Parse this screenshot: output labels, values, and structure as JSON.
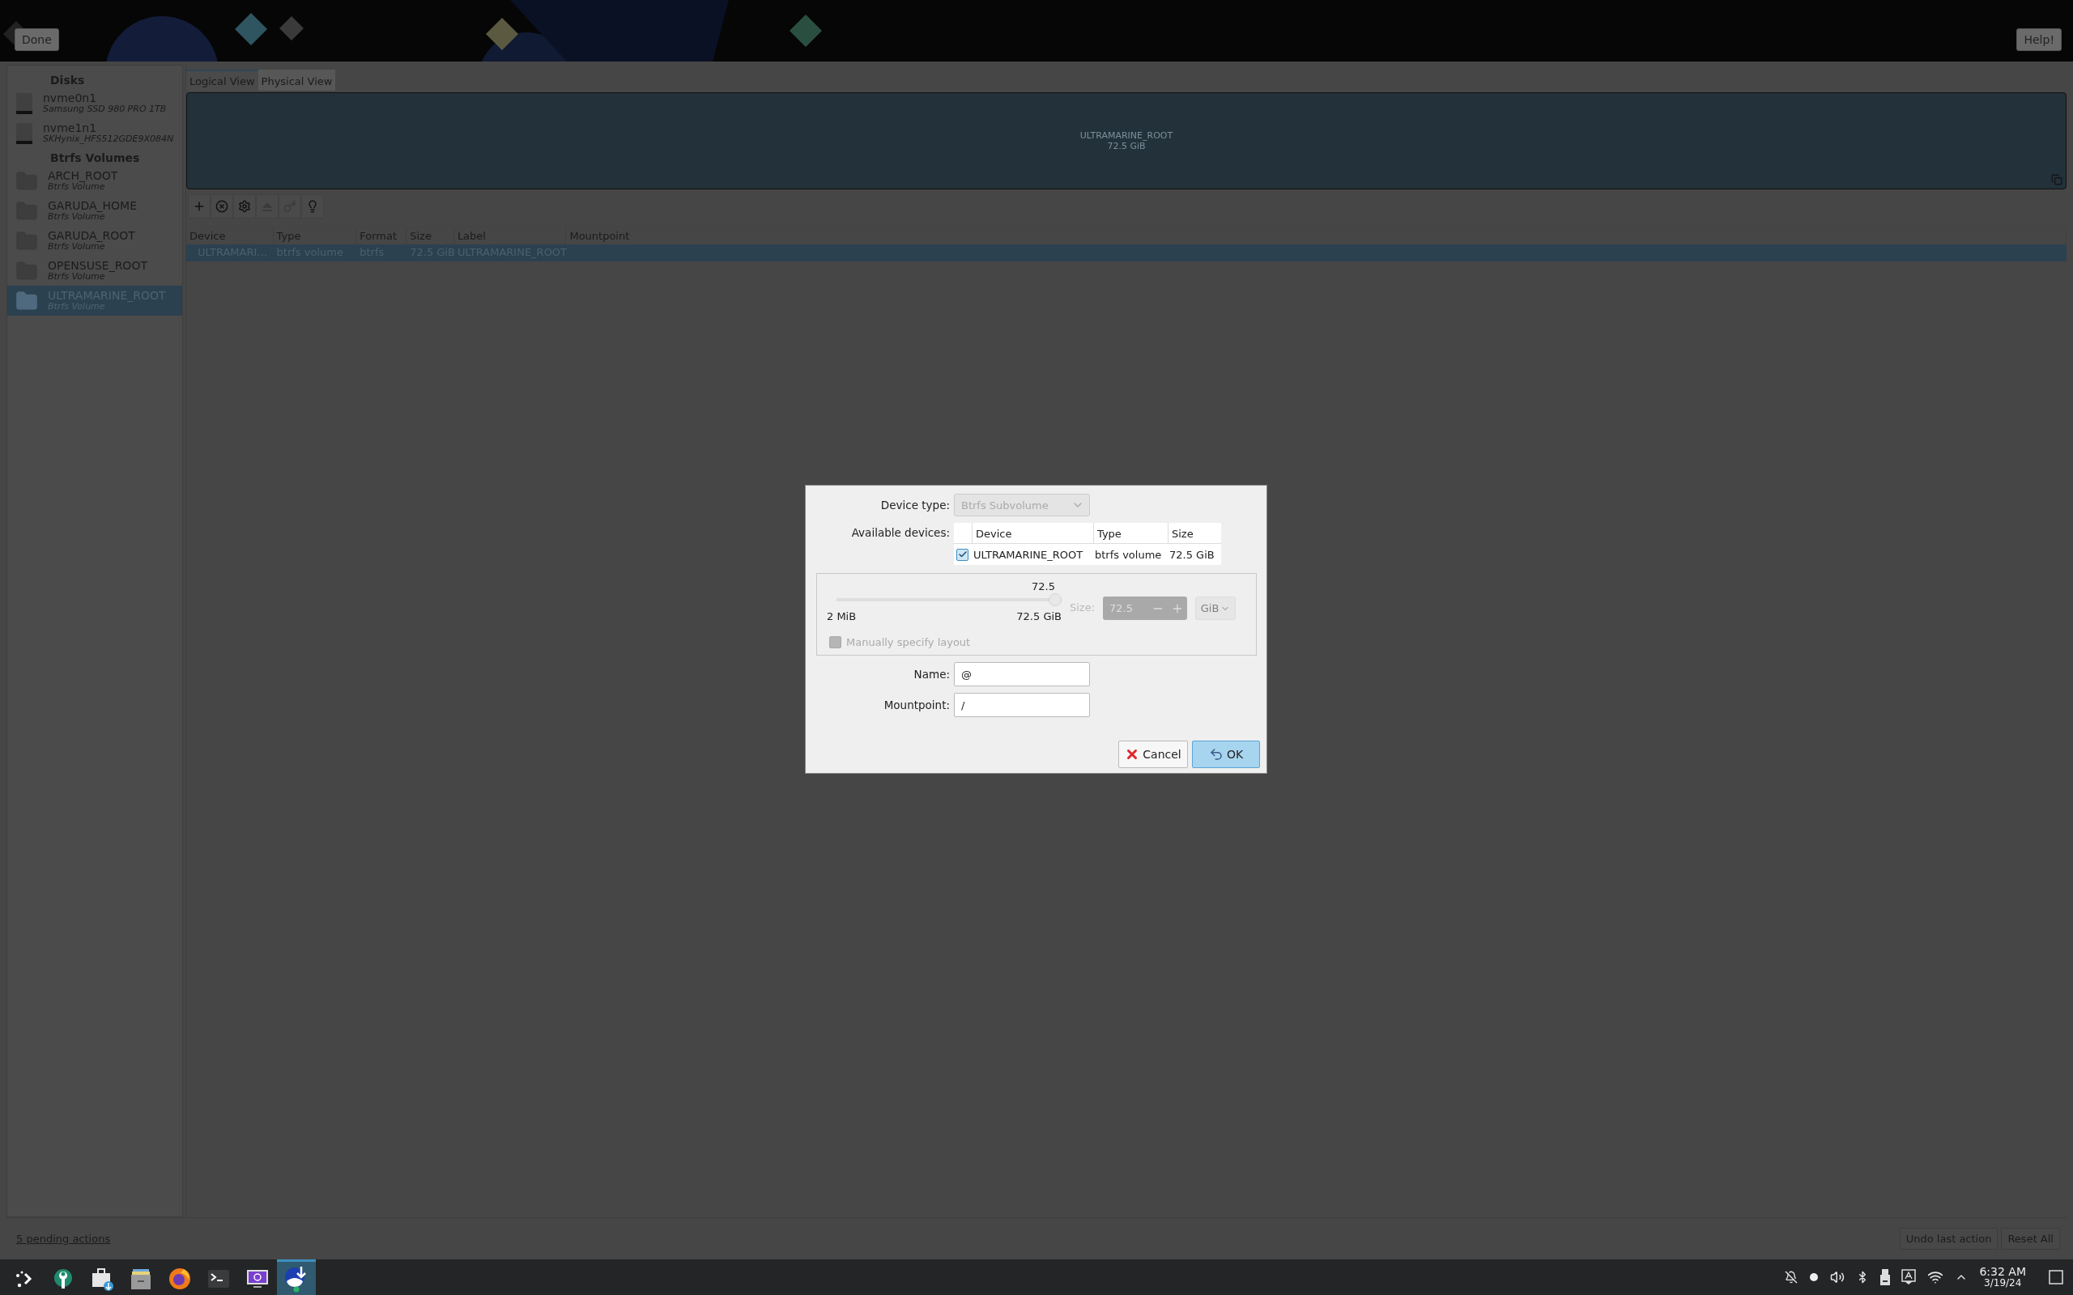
{
  "top_bar": {
    "done_button": "Done",
    "help_button": "Help!"
  },
  "sidebar": {
    "sections": [
      {
        "title": "Disks",
        "items": [
          {
            "name": "nvme0n1",
            "subtitle": "Samsung SSD 980 PRO 1TB",
            "kind": "disk",
            "selected": false
          },
          {
            "name": "nvme1n1",
            "subtitle": "SKHynix_HFS512GDE9X084N",
            "kind": "disk",
            "selected": false
          }
        ]
      },
      {
        "title": "Btrfs Volumes",
        "items": [
          {
            "name": "ARCH_ROOT",
            "subtitle": "Btrfs Volume",
            "kind": "volume",
            "selected": false
          },
          {
            "name": "GARUDA_HOME",
            "subtitle": "Btrfs Volume",
            "kind": "volume",
            "selected": false
          },
          {
            "name": "GARUDA_ROOT",
            "subtitle": "Btrfs Volume",
            "kind": "volume",
            "selected": false
          },
          {
            "name": "OPENSUSE_ROOT",
            "subtitle": "Btrfs Volume",
            "kind": "volume",
            "selected": false
          },
          {
            "name": "ULTRAMARINE_ROOT",
            "subtitle": "Btrfs Volume",
            "kind": "volume",
            "selected": true
          }
        ]
      }
    ]
  },
  "tabs": [
    {
      "label": "Logical View",
      "selected": true
    },
    {
      "label": "Physical View",
      "selected": false
    }
  ],
  "visualization": {
    "label": "ULTRAMARINE_ROOT",
    "size": "72.5 GiB"
  },
  "toolbar": [
    {
      "kind": "add",
      "disabled": false
    },
    {
      "kind": "remove",
      "disabled": false
    },
    {
      "kind": "configure",
      "disabled": false
    },
    {
      "kind": "eject",
      "disabled": true
    },
    {
      "kind": "key",
      "disabled": true
    },
    {
      "kind": "info",
      "disabled": false
    }
  ],
  "table": {
    "columns": [
      "Device",
      "Type",
      "Format",
      "Size",
      "Label",
      "Mountpoint"
    ],
    "rows": [
      {
        "cells": [
          "ULTRAMARI…",
          "btrfs volume",
          "btrfs",
          "72.5 GiB",
          "ULTRAMARINE_ROOT"
        ],
        "selected": true
      }
    ]
  },
  "footer": {
    "pending_link": "5 pending actions",
    "buttons": [
      "Undo last action",
      "Reset All"
    ]
  },
  "dialog": {
    "device_type": {
      "label": "Device type:",
      "value": "Btrfs Subvolume",
      "disabled": true
    },
    "available_devices": {
      "label": "Available devices:",
      "columns": [
        "Device",
        "Type",
        "Size"
      ],
      "rows": [
        {
          "checked": true,
          "cells": [
            "ULTRAMARINE_ROOT",
            "btrfs volume",
            "72.5 GiB"
          ]
        }
      ]
    },
    "size": {
      "value_label": "72.5",
      "min_label": "2 MiB",
      "max_label": "72.5 GiB",
      "level": 1,
      "size_label": "Size:",
      "spin_value": "72.5",
      "unit": "GiB",
      "disabled": true
    },
    "manual_layout": {
      "label": "Manually specify layout",
      "checked": false,
      "disabled": true
    },
    "name": {
      "label": "Name:",
      "value": "@"
    },
    "mountpoint": {
      "label": "Mountpoint:",
      "value": "/"
    },
    "buttons": [
      {
        "label": "Cancel",
        "kind": "cancel",
        "focused": false
      },
      {
        "label": "OK",
        "kind": "ok",
        "focused": true
      }
    ]
  },
  "taskbar": {
    "apps": [
      {
        "kind": "launcher",
        "active": false
      },
      {
        "kind": "settings",
        "active": false
      },
      {
        "kind": "store",
        "active": false
      },
      {
        "kind": "files",
        "active": false
      },
      {
        "kind": "browser",
        "active": false
      },
      {
        "kind": "terminal",
        "active": false
      },
      {
        "kind": "monitor",
        "active": false
      },
      {
        "kind": "installer",
        "active": true
      }
    ],
    "clock": {
      "time": "6:32 AM",
      "date": "3/19/24"
    }
  }
}
